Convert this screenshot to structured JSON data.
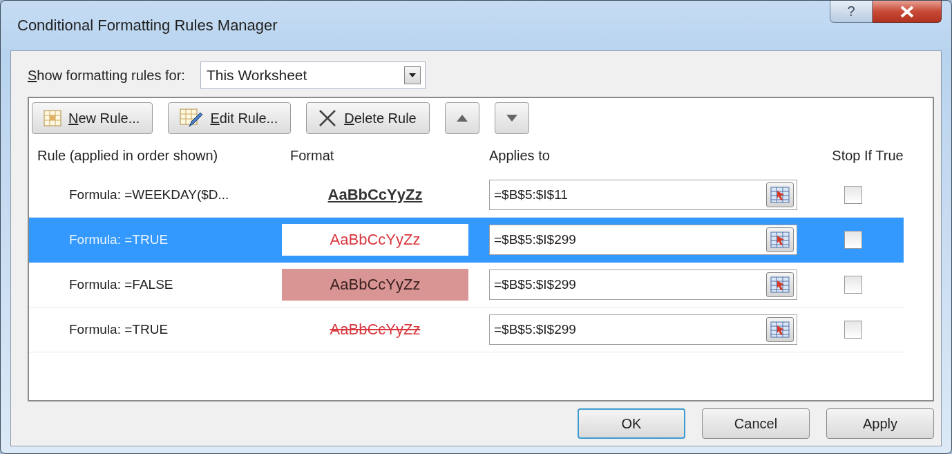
{
  "window": {
    "title": "Conditional Formatting Rules Manager",
    "controls": [
      {
        "kind": "help",
        "label": "?"
      },
      {
        "kind": "close"
      }
    ]
  },
  "scope": {
    "label_key": "S",
    "label_rest": "how formatting rules for:",
    "value": "This Worksheet"
  },
  "toolbar": [
    {
      "kind": "new",
      "key": "N",
      "rest": "ew Rule..."
    },
    {
      "kind": "edit",
      "key": "E",
      "rest": "dit Rule..."
    },
    {
      "kind": "delete",
      "key": "D",
      "rest": "elete Rule"
    },
    {
      "kind": "up"
    },
    {
      "kind": "down"
    }
  ],
  "columns": [
    "Rule (applied in order shown)",
    "Format",
    "Applies to",
    "Stop If True"
  ],
  "rules": [
    {
      "rule": "Formula: =WEEKDAY($D...",
      "format": {
        "text": "AaBbCcYyZz",
        "bold": true,
        "underline": true,
        "strikethrough": false,
        "color": "#333333"
      },
      "applies_to": "=$B$5:$I$11",
      "stop_if_true": false,
      "selected": false
    },
    {
      "rule": "Formula: =TRUE",
      "format": {
        "text": "AaBbCcYyZz",
        "bold": false,
        "underline": false,
        "strikethrough": false,
        "color": "#d9363e"
      },
      "applies_to": "=$B$5:$I$299",
      "stop_if_true": false,
      "selected": true
    },
    {
      "rule": "Formula: =FALSE",
      "format": {
        "text": "AaBbCcYyZz",
        "bold": false,
        "underline": false,
        "strikethrough": false,
        "color": "#3a2020",
        "fill": {
          "color": "#d99594"
        }
      },
      "applies_to": "=$B$5:$I$299",
      "stop_if_true": false,
      "selected": false
    },
    {
      "rule": "Formula: =TRUE",
      "format": {
        "text": "AaBbCcYyZz",
        "bold": false,
        "underline": false,
        "strikethrough": true,
        "color": "#d9363e"
      },
      "applies_to": "=$B$5:$I$299",
      "stop_if_true": false,
      "selected": false
    }
  ],
  "buttons": [
    {
      "label": "OK",
      "default": true
    },
    {
      "label": "Cancel",
      "default": false
    },
    {
      "label": "Apply",
      "default": false
    }
  ]
}
